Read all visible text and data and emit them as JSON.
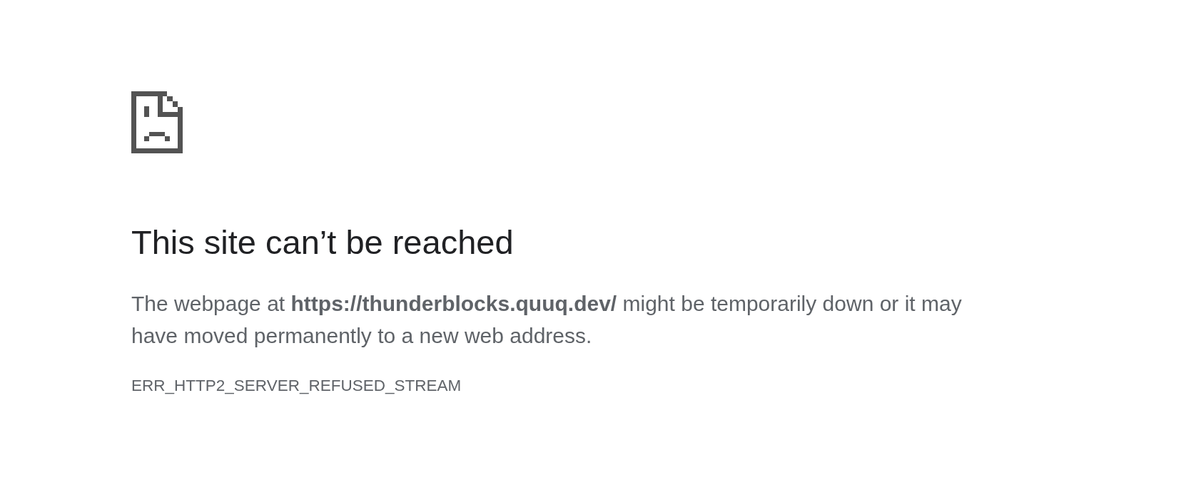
{
  "error_page": {
    "heading": "This site can’t be reached",
    "message": "The webpage at **https://thunderblocks.quuq.dev/** might be temporarily down or it may have moved permanently to a new web address.",
    "error_code": "ERR_HTTP2_SERVER_REFUSED_STREAM"
  }
}
